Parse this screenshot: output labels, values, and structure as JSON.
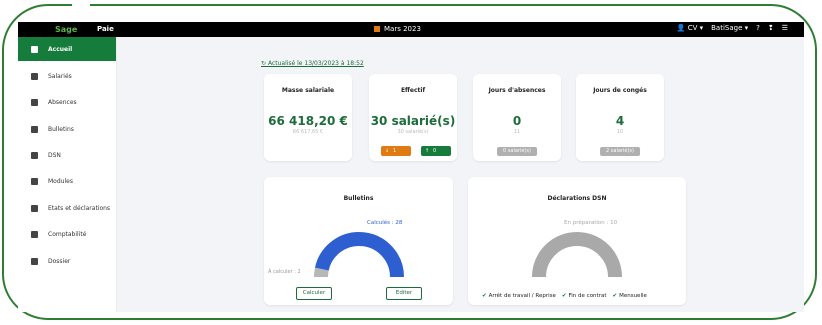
{
  "topbar": {
    "logo": "Sage",
    "module": "Paie",
    "period": "Mars 2023",
    "user": "CV ▾",
    "company": "BatiSage ▾",
    "help": "?",
    "notif": "❢",
    "menu": "☰"
  },
  "sidebar": {
    "items": [
      {
        "label": "Accueil",
        "icon": "home-icon"
      },
      {
        "label": "Salariés",
        "icon": "people-icon"
      },
      {
        "label": "Absences",
        "icon": "calendar-icon"
      },
      {
        "label": "Bulletins",
        "icon": "document-icon"
      },
      {
        "label": "DSN",
        "icon": "dsn-icon"
      },
      {
        "label": "Modules",
        "icon": "modules-icon"
      },
      {
        "label": "Etats et déclarations",
        "icon": "reports-icon"
      },
      {
        "label": "Comptabilité",
        "icon": "accounting-icon"
      },
      {
        "label": "Dossier",
        "icon": "folder-icon"
      }
    ]
  },
  "main": {
    "refresh_text": "Actualisé le 13/03/2023 à 18:52",
    "kpis": [
      {
        "title": "Masse salariale",
        "value": "66 418,20 €",
        "sub": "66 617,65 €"
      },
      {
        "title": "Effectif",
        "value": "30 salarié(s)",
        "sub": "30 salarié(s)",
        "down": "1",
        "up": "0"
      },
      {
        "title": "Jours d'absences",
        "value": "0",
        "sub": "11",
        "pill": "0 salarié(s)"
      },
      {
        "title": "Jours de congés",
        "value": "4",
        "sub": "10",
        "pill": "2 salarié(s)"
      }
    ],
    "bulletins": {
      "title": "Bulletins",
      "computed_label": "Calculés : 28",
      "todo_label": "À calculer : 2",
      "calc_button": "Calculer",
      "edit_button": "Editer"
    },
    "dsn": {
      "title": "Déclarations DSN",
      "prep_label": "En préparation : 10",
      "legend": [
        "Arrêt de travail / Reprise",
        "Fin de contrat",
        "Mensuelle"
      ]
    }
  },
  "chart_data": [
    {
      "type": "pie",
      "title": "Bulletins",
      "categories": [
        "Calculés",
        "À calculer"
      ],
      "values": [
        28,
        2
      ],
      "colors": [
        "#2e5fd0",
        "#b7b7b7"
      ]
    },
    {
      "type": "pie",
      "title": "Déclarations DSN",
      "categories": [
        "En préparation"
      ],
      "values": [
        10
      ],
      "colors": [
        "#a9a9a9"
      ]
    }
  ],
  "colors": {
    "brand_green": "#167c3c",
    "accent_orange": "#e07b12",
    "chart_blue": "#2e5fd0"
  }
}
